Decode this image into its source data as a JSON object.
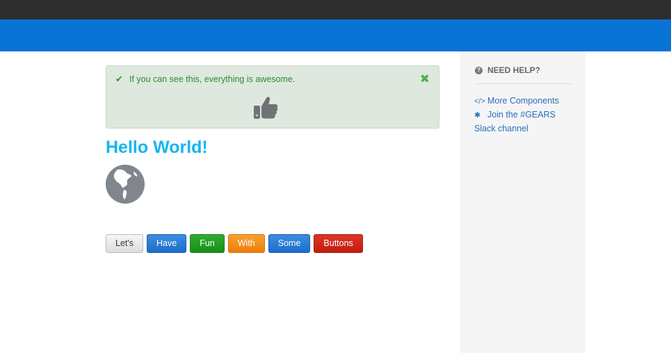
{
  "sidebar": {
    "heading": "NEED HELP?",
    "links": [
      {
        "label": "More Components",
        "icon": "code-icon"
      },
      {
        "label": "Join the #GEARS",
        "icon": "gear-icon"
      },
      {
        "label": "Slack channel"
      }
    ]
  },
  "alert": {
    "message": "If you can see this, everything is awesome.",
    "icon": "thumbs-up-icon"
  },
  "main": {
    "title": "Hello World!",
    "globe_icon": "globe-icon"
  },
  "buttons": [
    "Let's",
    "Have",
    "Fun",
    "With",
    "Some",
    "Buttons"
  ],
  "colors": {
    "topbar": "#2d2d2d",
    "header": "#0a73d6",
    "title": "#13b6ef",
    "alert_bg": "#dfe8df",
    "alert_text": "#2f8a2f"
  }
}
